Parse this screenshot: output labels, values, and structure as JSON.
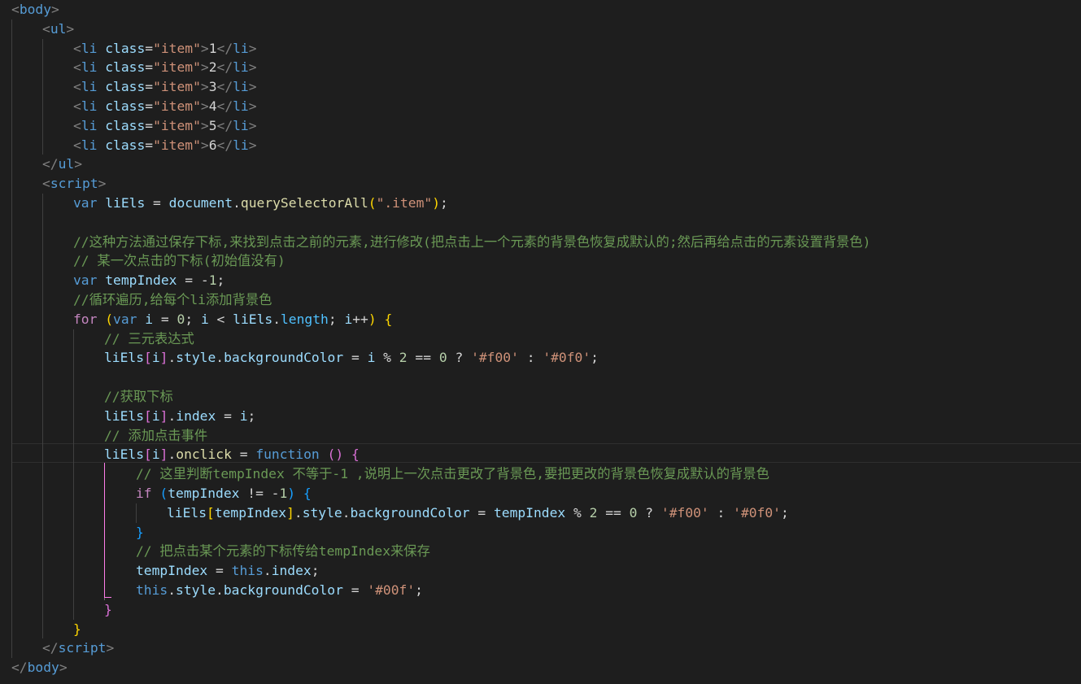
{
  "editor": {
    "theme": "dark",
    "background": "#1e1e1e",
    "lines": [
      [
        [
          "punc",
          "<"
        ],
        [
          "tag",
          "body"
        ],
        [
          "punc",
          ">"
        ]
      ],
      [
        [
          "punc",
          "<"
        ],
        [
          "tag",
          "ul"
        ],
        [
          "punc",
          ">"
        ]
      ],
      [
        [
          "punc",
          "<"
        ],
        [
          "tag",
          "li"
        ],
        [
          "txt",
          " "
        ],
        [
          "attr",
          "class"
        ],
        [
          "txt",
          "="
        ],
        [
          "str",
          "\"item\""
        ],
        [
          "punc",
          ">"
        ],
        [
          "txt",
          "1"
        ],
        [
          "punc",
          "</"
        ],
        [
          "tag",
          "li"
        ],
        [
          "punc",
          ">"
        ]
      ],
      [
        [
          "punc",
          "<"
        ],
        [
          "tag",
          "li"
        ],
        [
          "txt",
          " "
        ],
        [
          "attr",
          "class"
        ],
        [
          "txt",
          "="
        ],
        [
          "str",
          "\"item\""
        ],
        [
          "punc",
          ">"
        ],
        [
          "txt",
          "2"
        ],
        [
          "punc",
          "</"
        ],
        [
          "tag",
          "li"
        ],
        [
          "punc",
          ">"
        ]
      ],
      [
        [
          "punc",
          "<"
        ],
        [
          "tag",
          "li"
        ],
        [
          "txt",
          " "
        ],
        [
          "attr",
          "class"
        ],
        [
          "txt",
          "="
        ],
        [
          "str",
          "\"item\""
        ],
        [
          "punc",
          ">"
        ],
        [
          "txt",
          "3"
        ],
        [
          "punc",
          "</"
        ],
        [
          "tag",
          "li"
        ],
        [
          "punc",
          ">"
        ]
      ],
      [
        [
          "punc",
          "<"
        ],
        [
          "tag",
          "li"
        ],
        [
          "txt",
          " "
        ],
        [
          "attr",
          "class"
        ],
        [
          "txt",
          "="
        ],
        [
          "str",
          "\"item\""
        ],
        [
          "punc",
          ">"
        ],
        [
          "txt",
          "4"
        ],
        [
          "punc",
          "</"
        ],
        [
          "tag",
          "li"
        ],
        [
          "punc",
          ">"
        ]
      ],
      [
        [
          "punc",
          "<"
        ],
        [
          "tag",
          "li"
        ],
        [
          "txt",
          " "
        ],
        [
          "attr",
          "class"
        ],
        [
          "txt",
          "="
        ],
        [
          "str",
          "\"item\""
        ],
        [
          "punc",
          ">"
        ],
        [
          "txt",
          "5"
        ],
        [
          "punc",
          "</"
        ],
        [
          "tag",
          "li"
        ],
        [
          "punc",
          ">"
        ]
      ],
      [
        [
          "punc",
          "<"
        ],
        [
          "tag",
          "li"
        ],
        [
          "txt",
          " "
        ],
        [
          "attr",
          "class"
        ],
        [
          "txt",
          "="
        ],
        [
          "str",
          "\"item\""
        ],
        [
          "punc",
          ">"
        ],
        [
          "txt",
          "6"
        ],
        [
          "punc",
          "</"
        ],
        [
          "tag",
          "li"
        ],
        [
          "punc",
          ">"
        ]
      ],
      [
        [
          "punc",
          "</"
        ],
        [
          "tag",
          "ul"
        ],
        [
          "punc",
          ">"
        ]
      ],
      [
        [
          "punc",
          "<"
        ],
        [
          "tag",
          "script"
        ],
        [
          "punc",
          ">"
        ]
      ],
      [
        [
          "kw",
          "var"
        ],
        [
          "txt",
          " "
        ],
        [
          "var",
          "liEls"
        ],
        [
          "txt",
          " = "
        ],
        [
          "var",
          "document"
        ],
        [
          "txt",
          "."
        ],
        [
          "fn",
          "querySelectorAll"
        ],
        [
          "b1",
          "("
        ],
        [
          "str",
          "\".item\""
        ],
        [
          "b1",
          ")"
        ],
        [
          "txt",
          ";"
        ]
      ],
      [],
      [
        [
          "cmt",
          "//这种方法通过保存下标,来找到点击之前的元素,进行修改(把点击上一个元素的背景色恢复成默认的;然后再给点击的元素设置背景色)"
        ]
      ],
      [
        [
          "cmt",
          "// 某一次点击的下标(初始值没有)"
        ]
      ],
      [
        [
          "kw",
          "var"
        ],
        [
          "txt",
          " "
        ],
        [
          "var",
          "tempIndex"
        ],
        [
          "txt",
          " = -"
        ],
        [
          "num",
          "1"
        ],
        [
          "txt",
          ";"
        ]
      ],
      [
        [
          "cmt",
          "//循环遍历,给每个li添加背景色"
        ]
      ],
      [
        [
          "ctl",
          "for"
        ],
        [
          "txt",
          " "
        ],
        [
          "b1",
          "("
        ],
        [
          "kw",
          "var"
        ],
        [
          "txt",
          " "
        ],
        [
          "var",
          "i"
        ],
        [
          "txt",
          " = "
        ],
        [
          "num",
          "0"
        ],
        [
          "txt",
          "; "
        ],
        [
          "var",
          "i"
        ],
        [
          "txt",
          " < "
        ],
        [
          "var",
          "liEls"
        ],
        [
          "txt",
          "."
        ],
        [
          "prop",
          "length"
        ],
        [
          "txt",
          "; "
        ],
        [
          "var",
          "i"
        ],
        [
          "txt",
          "++"
        ],
        [
          "b1",
          ")"
        ],
        [
          "txt",
          " "
        ],
        [
          "b1",
          "{"
        ]
      ],
      [
        [
          "cmt",
          "// 三元表达式"
        ]
      ],
      [
        [
          "var",
          "liEls"
        ],
        [
          "b2",
          "["
        ],
        [
          "var",
          "i"
        ],
        [
          "b2",
          "]"
        ],
        [
          "txt",
          "."
        ],
        [
          "var",
          "style"
        ],
        [
          "txt",
          "."
        ],
        [
          "var",
          "backgroundColor"
        ],
        [
          "txt",
          " = "
        ],
        [
          "var",
          "i"
        ],
        [
          "txt",
          " % "
        ],
        [
          "num",
          "2"
        ],
        [
          "txt",
          " == "
        ],
        [
          "num",
          "0"
        ],
        [
          "txt",
          " ? "
        ],
        [
          "str",
          "'#f00'"
        ],
        [
          "txt",
          " : "
        ],
        [
          "str",
          "'#0f0'"
        ],
        [
          "txt",
          ";"
        ]
      ],
      [],
      [
        [
          "cmt",
          "//获取下标"
        ]
      ],
      [
        [
          "var",
          "liEls"
        ],
        [
          "b2",
          "["
        ],
        [
          "var",
          "i"
        ],
        [
          "b2",
          "]"
        ],
        [
          "txt",
          "."
        ],
        [
          "var",
          "index"
        ],
        [
          "txt",
          " = "
        ],
        [
          "var",
          "i"
        ],
        [
          "txt",
          ";"
        ]
      ],
      [
        [
          "cmt",
          "// 添加点击事件"
        ]
      ],
      [
        [
          "var",
          "liEls"
        ],
        [
          "b2",
          "["
        ],
        [
          "var",
          "i"
        ],
        [
          "b2",
          "]"
        ],
        [
          "txt",
          "."
        ],
        [
          "fn",
          "onclick"
        ],
        [
          "txt",
          " = "
        ],
        [
          "kw",
          "function"
        ],
        [
          "txt",
          " "
        ],
        [
          "b2",
          "("
        ],
        [
          "b2",
          ")"
        ],
        [
          "txt",
          " "
        ],
        [
          "b2",
          "{"
        ]
      ],
      [
        [
          "cmt",
          "// 这里判断tempIndex 不等于-1 ,说明上一次点击更改了背景色,要把更改的背景色恢复成默认的背景色"
        ]
      ],
      [
        [
          "ctl",
          "if"
        ],
        [
          "txt",
          " "
        ],
        [
          "b3",
          "("
        ],
        [
          "var",
          "tempIndex"
        ],
        [
          "txt",
          " != -"
        ],
        [
          "num",
          "1"
        ],
        [
          "b3",
          ")"
        ],
        [
          "txt",
          " "
        ],
        [
          "b3",
          "{"
        ]
      ],
      [
        [
          "var",
          "liEls"
        ],
        [
          "b1",
          "["
        ],
        [
          "var",
          "tempIndex"
        ],
        [
          "b1",
          "]"
        ],
        [
          "txt",
          "."
        ],
        [
          "var",
          "style"
        ],
        [
          "txt",
          "."
        ],
        [
          "var",
          "backgroundColor"
        ],
        [
          "txt",
          " = "
        ],
        [
          "var",
          "tempIndex"
        ],
        [
          "txt",
          " % "
        ],
        [
          "num",
          "2"
        ],
        [
          "txt",
          " == "
        ],
        [
          "num",
          "0"
        ],
        [
          "txt",
          " ? "
        ],
        [
          "str",
          "'#f00'"
        ],
        [
          "txt",
          " : "
        ],
        [
          "str",
          "'#0f0'"
        ],
        [
          "txt",
          ";"
        ]
      ],
      [
        [
          "b3",
          "}"
        ]
      ],
      [
        [
          "cmt",
          "// 把点击某个元素的下标传给tempIndex来保存"
        ]
      ],
      [
        [
          "var",
          "tempIndex"
        ],
        [
          "txt",
          " = "
        ],
        [
          "kw",
          "this"
        ],
        [
          "txt",
          "."
        ],
        [
          "var",
          "index"
        ],
        [
          "txt",
          ";"
        ]
      ],
      [
        [
          "kw",
          "this"
        ],
        [
          "txt",
          "."
        ],
        [
          "var",
          "style"
        ],
        [
          "txt",
          "."
        ],
        [
          "var",
          "backgroundColor"
        ],
        [
          "txt",
          " = "
        ],
        [
          "str",
          "'#00f'"
        ],
        [
          "txt",
          ";"
        ]
      ],
      [
        [
          "b2",
          "}"
        ]
      ],
      [
        [
          "b1",
          "}"
        ]
      ],
      [
        [
          "punc",
          "</"
        ],
        [
          "tag",
          "script"
        ],
        [
          "punc",
          ">"
        ]
      ],
      [
        [
          "punc",
          "</"
        ],
        [
          "tag",
          "body"
        ],
        [
          "punc",
          ">"
        ]
      ]
    ]
  }
}
